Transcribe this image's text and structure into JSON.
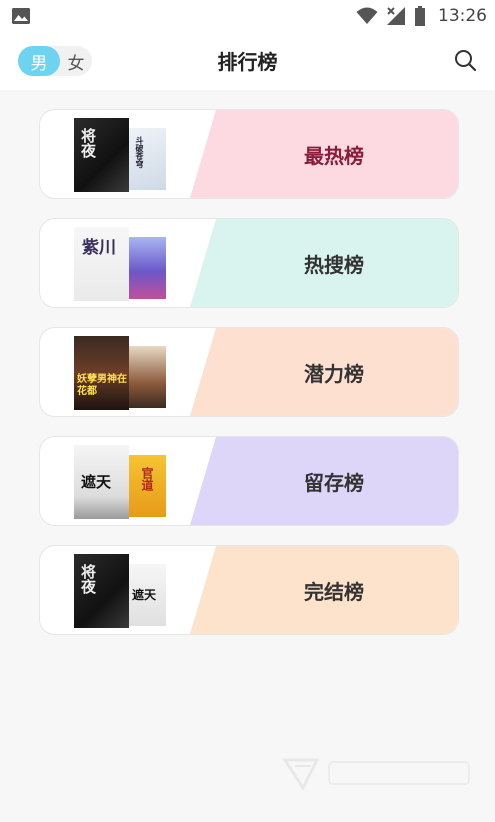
{
  "status_bar": {
    "time": "13:26"
  },
  "header": {
    "title": "排行榜",
    "gender_male": "男",
    "gender_female": "女"
  },
  "ranks": [
    {
      "label": "最热榜",
      "bg_color": "#fdd9e2",
      "label_color": "#8a1c3a",
      "cover_a_text": "将夜",
      "cover_b_text": "斗破苍穹"
    },
    {
      "label": "热搜榜",
      "bg_color": "#d9f3ef",
      "label_color": "#333333",
      "cover_a_text": "紫川",
      "cover_b_text": ""
    },
    {
      "label": "潜力榜",
      "bg_color": "#fde0d0",
      "label_color": "#333333",
      "cover_a_text": "妖孽男神在花都",
      "cover_b_text": ""
    },
    {
      "label": "留存榜",
      "bg_color": "#ddd6f8",
      "label_color": "#333333",
      "cover_a_text": "遮天",
      "cover_b_text": "官道"
    },
    {
      "label": "完结榜",
      "bg_color": "#fde3cc",
      "label_color": "#333333",
      "cover_a_text": "将夜",
      "cover_b_text": "遮天"
    }
  ],
  "icons": {
    "gallery": "gallery-icon",
    "wifi": "wifi-icon",
    "signal": "signal-icon",
    "battery": "battery-icon",
    "search": "search-icon"
  }
}
